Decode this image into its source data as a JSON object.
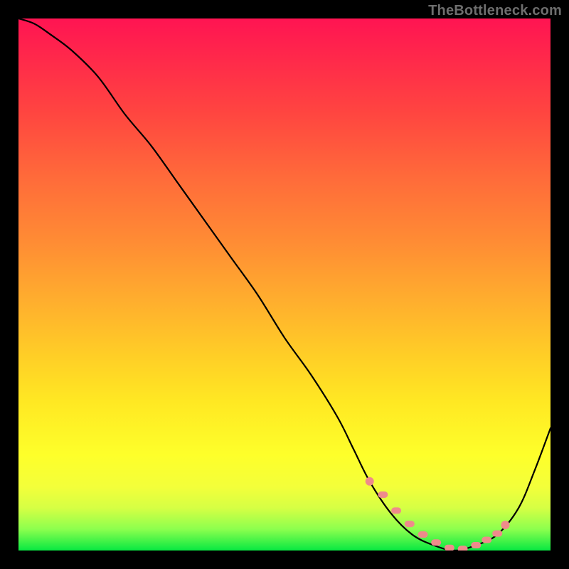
{
  "attribution": "TheBottleneck.com",
  "chart_data": {
    "type": "line",
    "title": "",
    "xlabel": "",
    "ylabel": "",
    "x_range": [
      0,
      100
    ],
    "y_range": [
      0,
      100
    ],
    "series": [
      {
        "name": "bottleneck-curve",
        "x": [
          0,
          3,
          6,
          10,
          15,
          20,
          25,
          30,
          35,
          40,
          45,
          50,
          55,
          60,
          63,
          66,
          70,
          74,
          78,
          82,
          86,
          90,
          94,
          97,
          100
        ],
        "y": [
          100,
          99,
          97,
          94,
          89,
          82,
          76,
          69,
          62,
          55,
          48,
          40,
          33,
          25,
          19,
          13,
          7,
          3,
          1,
          0,
          1,
          3,
          8,
          15,
          23
        ]
      }
    ],
    "markers": {
      "name": "highlight-dots",
      "color": "#ef8b8b",
      "x": [
        66,
        68.5,
        71,
        73.5,
        76,
        78.5,
        81,
        83.5,
        86,
        88,
        90,
        91.5
      ],
      "y": [
        13,
        10.5,
        7.5,
        5,
        3,
        1.5,
        0.5,
        0.3,
        1,
        2,
        3.2,
        4.8
      ]
    },
    "gradient_stops": [
      {
        "pos": 0,
        "color": "#ff1452"
      },
      {
        "pos": 18,
        "color": "#ff4640"
      },
      {
        "pos": 42,
        "color": "#ff8c34"
      },
      {
        "pos": 64,
        "color": "#ffd026"
      },
      {
        "pos": 82,
        "color": "#feff2a"
      },
      {
        "pos": 96,
        "color": "#8cff4e"
      },
      {
        "pos": 100,
        "color": "#08e842"
      }
    ]
  }
}
